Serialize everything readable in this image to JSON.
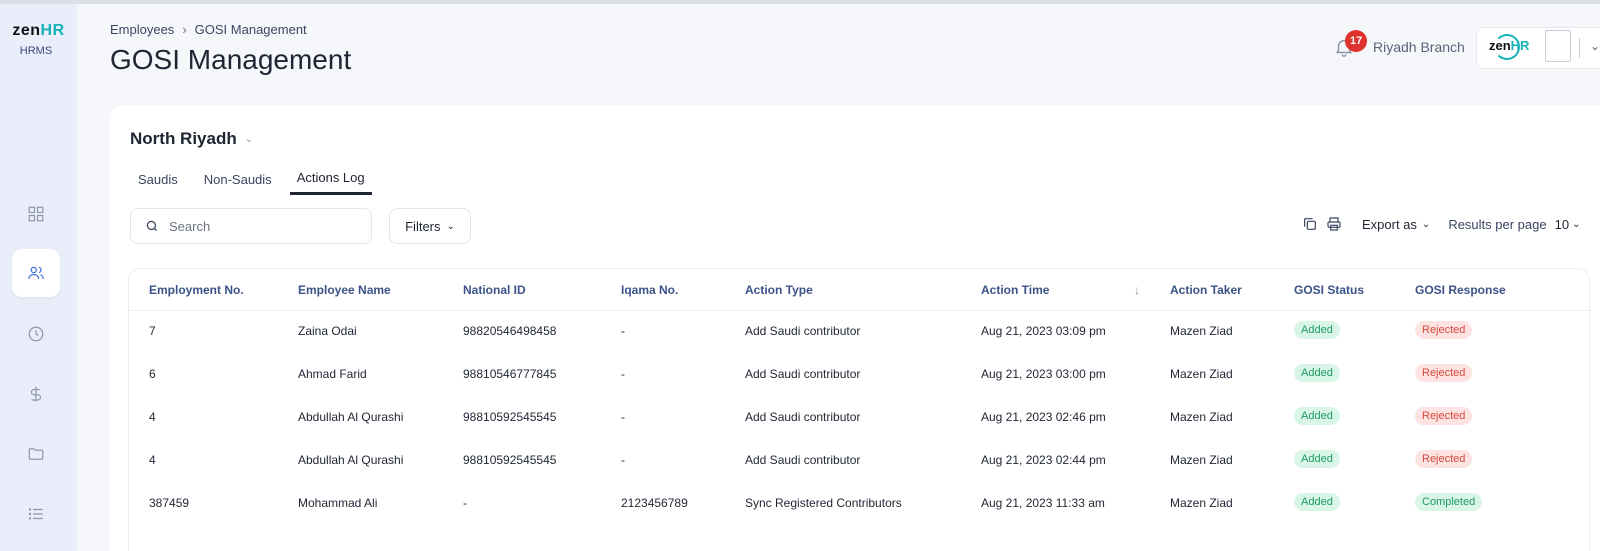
{
  "brand": {
    "logo_main": "zen",
    "logo_accent": "HR",
    "logo_sub": "HRMS"
  },
  "breadcrumb": {
    "parent": "Employees",
    "current": "GOSI Management"
  },
  "page_title": "GOSI Management",
  "header": {
    "notification_count": "17",
    "branch": "Riyadh Branch",
    "user_logo_main": "zen",
    "user_logo_accent": "HR"
  },
  "sidebar": {
    "items": [
      {
        "name": "dashboard",
        "icon": "grid-icon"
      },
      {
        "name": "employees",
        "icon": "users-icon",
        "active": true
      },
      {
        "name": "time",
        "icon": "clock-icon"
      },
      {
        "name": "payroll",
        "icon": "dollar-icon"
      },
      {
        "name": "documents",
        "icon": "folder-icon"
      },
      {
        "name": "lists",
        "icon": "list-icon"
      }
    ]
  },
  "section": {
    "title": "North Riyadh"
  },
  "tabs": [
    {
      "label": "Saudis"
    },
    {
      "label": "Non-Saudis"
    },
    {
      "label": "Actions Log",
      "active": true
    }
  ],
  "toolbar": {
    "search_placeholder": "Search",
    "filters_label": "Filters",
    "export_label": "Export as",
    "results_per_page_label": "Results per page",
    "results_per_page_value": "10"
  },
  "table": {
    "columns": [
      "Employment No.",
      "Employee Name",
      "National ID",
      "Iqama No.",
      "Action Type",
      "Action Time",
      "Action Taker",
      "GOSI Status",
      "GOSI Response"
    ],
    "rows": [
      {
        "employment_no": "7",
        "name": "Zaina Odai",
        "national_id": "98820546498458",
        "iqama": "-",
        "action_type": "Add Saudi contributor",
        "action_time": "Aug 21, 2023 03:09 pm",
        "taker": "Mazen Ziad",
        "status": "Added",
        "response": "Rejected",
        "response_kind": "rejected"
      },
      {
        "employment_no": "6",
        "name": "Ahmad Farid",
        "national_id": "98810546777845",
        "iqama": "-",
        "action_type": "Add Saudi contributor",
        "action_time": "Aug 21, 2023 03:00 pm",
        "taker": "Mazen Ziad",
        "status": "Added",
        "response": "Rejected",
        "response_kind": "rejected"
      },
      {
        "employment_no": "4",
        "name": "Abdullah Al Qurashi",
        "national_id": "98810592545545",
        "iqama": "-",
        "action_type": "Add Saudi contributor",
        "action_time": "Aug 21, 2023 02:46 pm",
        "taker": "Mazen Ziad",
        "status": "Added",
        "response": "Rejected",
        "response_kind": "rejected"
      },
      {
        "employment_no": "4",
        "name": "Abdullah Al Qurashi",
        "national_id": "98810592545545",
        "iqama": "-",
        "action_type": "Add Saudi contributor",
        "action_time": "Aug 21, 2023 02:44 pm",
        "taker": "Mazen Ziad",
        "status": "Added",
        "response": "Rejected",
        "response_kind": "rejected"
      },
      {
        "employment_no": "387459",
        "name": "Mohammad Ali",
        "national_id": "-",
        "iqama": "2123456789",
        "action_type": "Sync Registered Contributors",
        "action_time": "Aug 21, 2023 11:33 am",
        "taker": "Mazen Ziad",
        "status": "Added",
        "response": "Completed",
        "response_kind": "completed"
      }
    ]
  },
  "colors": {
    "accent": "#16b3b8",
    "badge": "#e0322d",
    "header_text": "#3b5388",
    "added_bg": "#d8f5e7",
    "rejected_bg": "#fde3e1"
  }
}
